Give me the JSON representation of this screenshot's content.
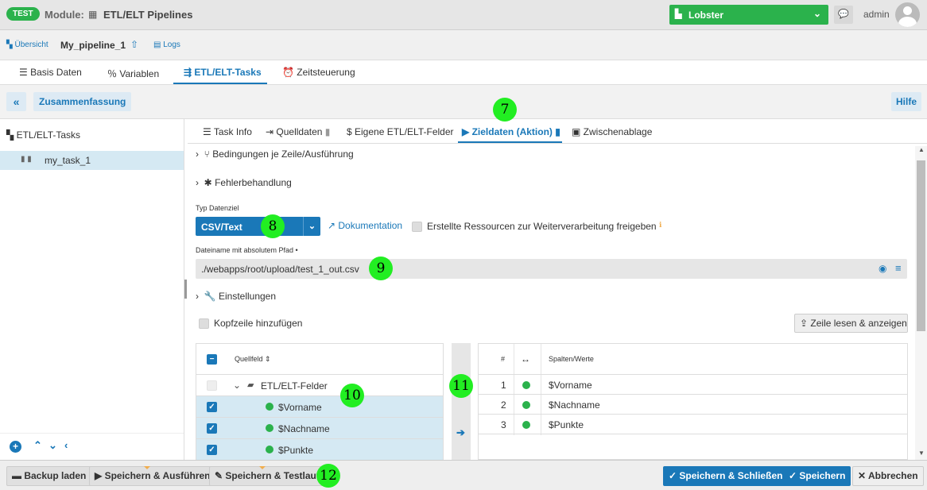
{
  "header": {
    "env_badge": "TEST",
    "module_label": "Module:",
    "module_name": "ETL/ELT Pipelines",
    "tenant": "Lobster",
    "user": "admin"
  },
  "nav": {
    "overview": "Übersicht",
    "pipeline_name": "My_pipeline_1",
    "logs": "Logs"
  },
  "main_tabs": [
    "Basis Daten",
    "Variablen",
    "ETL/ELT-Tasks",
    "Zeitsteuerung"
  ],
  "toolbar": {
    "summary": "Zusammenfassung",
    "help": "Hilfe"
  },
  "sidebar": {
    "title": "ETL/ELT-Tasks",
    "items": [
      {
        "label": "my_task_1"
      }
    ]
  },
  "task_tabs": [
    "Task Info",
    "Quelldaten",
    "Eigene ETL/ELT-Felder",
    "Zieldaten (Aktion)",
    "Zwischenablage"
  ],
  "sections": {
    "conditions": "Bedingungen je Zeile/Ausführung",
    "errors": "Fehlerbehandlung",
    "settings": "Einstellungen"
  },
  "target": {
    "type_label": "Typ Datenziel",
    "type_value": "CSV/Text",
    "doc_link": "Dokumentation",
    "release_label": "Erstellte Ressourcen zur Weiterverarbeitung freigeben",
    "path_label": "Dateiname mit absolutem Pfad •",
    "path_value": "./webapps/root/upload/test_1_out.csv",
    "header_row_label": "Kopfzeile hinzufügen",
    "read_button": "Zeile lesen & anzeigen"
  },
  "source_table": {
    "column": "Quellfeld",
    "folder": "ETL/ELT-Felder",
    "fields": [
      "$Vorname",
      "$Nachname",
      "$Punkte"
    ]
  },
  "target_table": {
    "col_num": "#",
    "col_value": "Spalten/Werte",
    "rows": [
      {
        "num": "1",
        "value": "$Vorname"
      },
      {
        "num": "2",
        "value": "$Nachname"
      },
      {
        "num": "3",
        "value": "$Punkte"
      }
    ]
  },
  "footer": {
    "backup": "Backup laden",
    "save_run": "Speichern & Ausführen",
    "save_test": "Speichern & Testlauf",
    "save_close": "Speichern & Schließen",
    "save": "Speichern",
    "cancel": "Abbrechen"
  },
  "markers": [
    "7",
    "8",
    "9",
    "10",
    "11",
    "12"
  ],
  "colors": {
    "accent": "#1a78b8",
    "success": "#2bb24c",
    "marker": "#22ee22"
  }
}
